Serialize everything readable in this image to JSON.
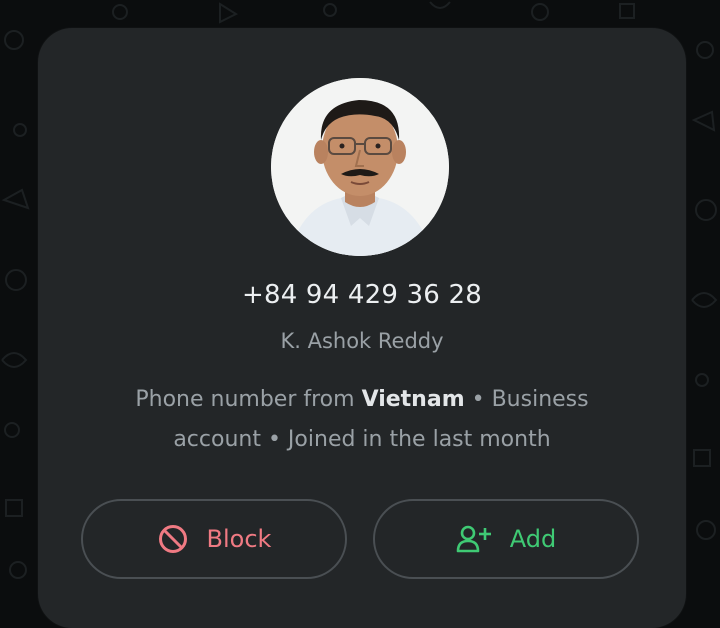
{
  "contact": {
    "phone": "+84 94 429 36 28",
    "name": "K. Ashok Reddy",
    "info": {
      "prefix": "Phone number from ",
      "country": "Vietnam",
      "suffix": " • Business account • Joined in the last month"
    }
  },
  "actions": {
    "block_label": "Block",
    "add_label": "Add"
  },
  "colors": {
    "card_background": "#232628",
    "block_red": "#f07a83",
    "add_green": "#3fca74"
  },
  "icons": {
    "block": "block-icon",
    "add": "add-contact-icon"
  }
}
